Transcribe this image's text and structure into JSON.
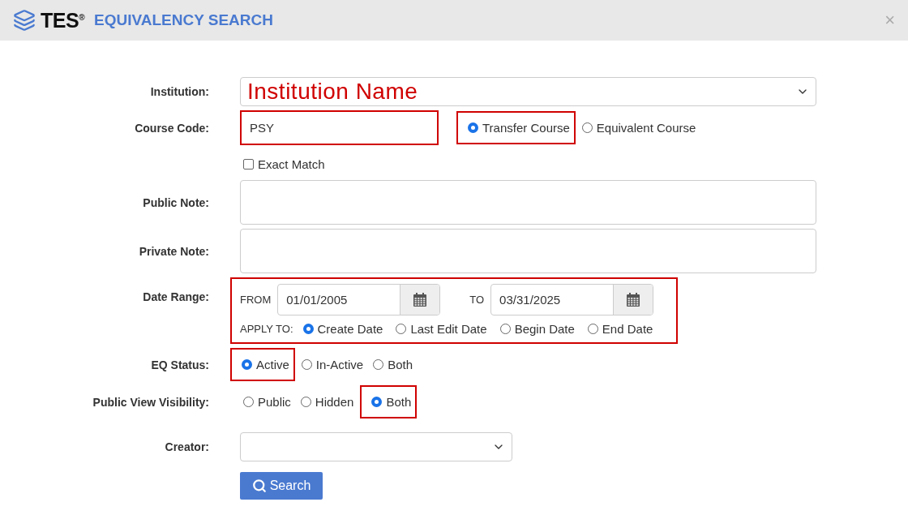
{
  "header": {
    "brand": "TES",
    "brand_mark": "®",
    "title": "EQUIVALENCY SEARCH",
    "close": "×"
  },
  "form": {
    "institution": {
      "label": "Institution:",
      "annotation": "Institution Name"
    },
    "course_code": {
      "label": "Course Code:",
      "value": "PSY",
      "highlighted": true,
      "options": [
        {
          "label": "Transfer Course",
          "selected": true,
          "highlighted": true
        },
        {
          "label": "Equivalent Course",
          "selected": false,
          "highlighted": false
        }
      ]
    },
    "exact_match": {
      "label": "Exact Match",
      "checked": false
    },
    "public_note": {
      "label": "Public Note:"
    },
    "private_note": {
      "label": "Private Note:"
    },
    "date_range": {
      "label": "Date Range:",
      "highlighted": true,
      "from_label": "FROM",
      "from": "01/01/2005",
      "to_label": "TO",
      "to": "03/31/2025",
      "apply_label": "APPLY TO:",
      "apply_options": [
        {
          "label": "Create Date",
          "selected": true
        },
        {
          "label": "Last Edit Date",
          "selected": false
        },
        {
          "label": "Begin Date",
          "selected": false
        },
        {
          "label": "End Date",
          "selected": false
        }
      ]
    },
    "eq_status": {
      "label": "EQ Status:",
      "options": [
        {
          "label": "Active",
          "selected": true,
          "highlighted": true
        },
        {
          "label": "In-Active",
          "selected": false,
          "highlighted": false
        },
        {
          "label": "Both",
          "selected": false,
          "highlighted": false
        }
      ]
    },
    "visibility": {
      "label": "Public View Visibility:",
      "options": [
        {
          "label": "Public",
          "selected": false,
          "highlighted": false
        },
        {
          "label": "Hidden",
          "selected": false,
          "highlighted": false
        },
        {
          "label": "Both",
          "selected": true,
          "highlighted": true
        }
      ]
    },
    "creator": {
      "label": "Creator:"
    },
    "search_button": "Search"
  }
}
